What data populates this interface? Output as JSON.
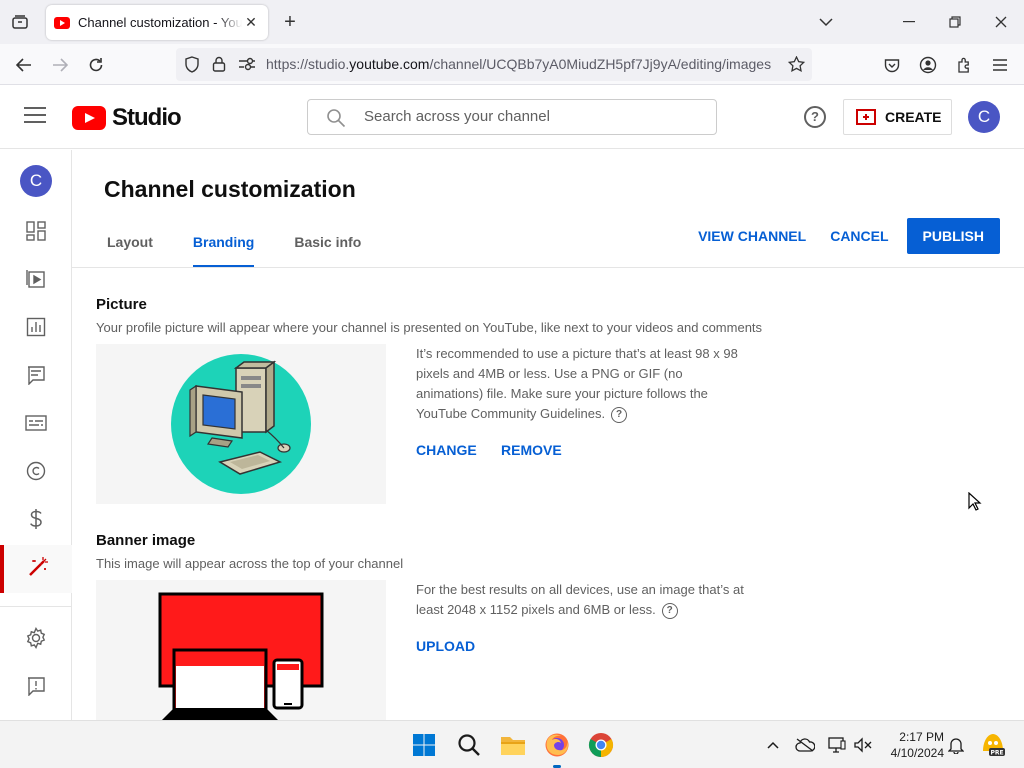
{
  "browser": {
    "tab_title": "Channel customization - YouTube Studio",
    "tab_close": "✕",
    "new_tab": "+",
    "url_prefix": "https://studio.",
    "url_domain": "youtube.com",
    "url_path": "/channel/UCQBb7yA0MiudZH5pf7Jj9yA/editing/images"
  },
  "header": {
    "logo_text": "Studio",
    "search_placeholder": "Search across your channel",
    "help_label": "?",
    "create_label": "CREATE",
    "avatar_initial": "C"
  },
  "sidebar": {
    "avatar_initial": "C",
    "items": [
      "dashboard",
      "content",
      "analytics",
      "comments",
      "subtitles",
      "copyright",
      "earn",
      "customization",
      "settings",
      "feedback"
    ],
    "active": "customization"
  },
  "page": {
    "title": "Channel customization",
    "tabs": [
      {
        "label": "Layout",
        "active": false
      },
      {
        "label": "Branding",
        "active": true
      },
      {
        "label": "Basic info",
        "active": false
      }
    ],
    "view_channel": "VIEW CHANNEL",
    "cancel": "CANCEL",
    "publish": "PUBLISH"
  },
  "picture": {
    "title": "Picture",
    "desc": "Your profile picture will appear where your channel is presented on YouTube, like next to your videos and comments",
    "info": "It’s recommended to use a picture that’s at least 98 x 98 pixels and 4MB or less. Use a PNG or GIF (no animations) file. Make sure your picture follows the YouTube Community Guidelines.",
    "change": "CHANGE",
    "remove": "REMOVE"
  },
  "banner": {
    "title": "Banner image",
    "desc": "This image will appear across the top of your channel",
    "info": "For the best results on all devices, use an image that’s at least 2048 x 1152 pixels and 6MB or less.",
    "upload": "UPLOAD"
  },
  "taskbar": {
    "time": "2:17 PM",
    "date": "4/10/2024",
    "icons": [
      "windows-start",
      "search",
      "file-explorer",
      "firefox",
      "chrome"
    ]
  },
  "colors": {
    "accent_blue": "#065fd4",
    "brand_red": "#ff0000",
    "avatar": "#4a56c4",
    "profile_circle": "#1dd3b8"
  }
}
